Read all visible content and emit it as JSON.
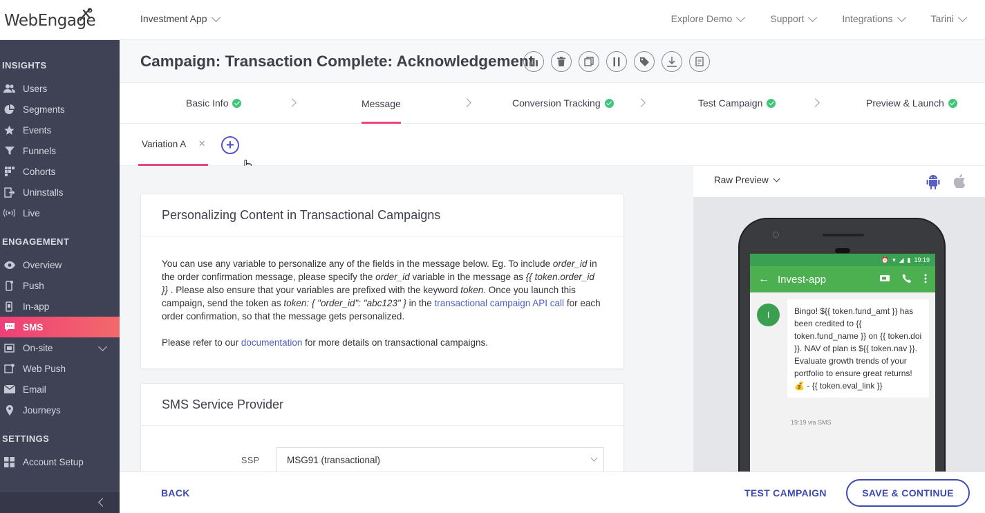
{
  "brand": {
    "logo_text": "WebEngage",
    "accent": "#e8467e",
    "primary": "#3d4bb0",
    "sidebar_bg": "#3f4255"
  },
  "topbar": {
    "app_name": "Investment App",
    "menu": [
      "Explore Demo",
      "Support",
      "Integrations",
      "Tarini"
    ]
  },
  "sidebar": {
    "sections": [
      {
        "title": "INSIGHTS",
        "items": [
          {
            "label": "Users",
            "icon": "users-icon"
          },
          {
            "label": "Segments",
            "icon": "pie-icon"
          },
          {
            "label": "Events",
            "icon": "star-icon"
          },
          {
            "label": "Funnels",
            "icon": "funnel-icon"
          },
          {
            "label": "Cohorts",
            "icon": "grid-icon"
          },
          {
            "label": "Uninstalls",
            "icon": "uninstall-icon"
          },
          {
            "label": "Live",
            "icon": "broadcast-icon"
          }
        ]
      },
      {
        "title": "ENGAGEMENT",
        "items": [
          {
            "label": "Overview",
            "icon": "eye-icon"
          },
          {
            "label": "Push",
            "icon": "mobile-icon"
          },
          {
            "label": "In-app",
            "icon": "mobile-icon"
          },
          {
            "label": "SMS",
            "icon": "sms-icon"
          },
          {
            "label": "On-site",
            "icon": "window-icon"
          },
          {
            "label": "Web Push",
            "icon": "webpush-icon"
          },
          {
            "label": "Email",
            "icon": "mail-icon"
          },
          {
            "label": "Journeys",
            "icon": "journey-icon"
          }
        ]
      },
      {
        "title": "SETTINGS",
        "items": [
          {
            "label": "Account Setup",
            "icon": "grid-icon"
          }
        ]
      }
    ]
  },
  "campaign": {
    "title": "Campaign: Transaction Complete: Acknowledgement",
    "actions": [
      "stats-icon",
      "delete-icon",
      "copy-icon",
      "pause-icon",
      "tag-icon",
      "download-icon",
      "report-icon"
    ]
  },
  "steps": [
    {
      "label": "Basic Info",
      "done": true
    },
    {
      "label": "Message",
      "done": false,
      "active": true
    },
    {
      "label": "Conversion Tracking",
      "done": true
    },
    {
      "label": "Test Campaign",
      "done": true
    },
    {
      "label": "Preview & Launch",
      "done": true
    }
  ],
  "variation": {
    "tab_label": "Variation A",
    "close": "×",
    "add": "+"
  },
  "personalize_card": {
    "title": "Personalizing Content in Transactional Campaigns",
    "p1_a": "You can use any variable to personalize any of the fields in the message below. Eg. To include ",
    "p1_order_id": "order_id",
    "p1_b": " in the order confirmation message, please specify the ",
    "p1_order_id2": "order_id",
    "p1_c": " variable in the message as ",
    "p1_token": "{{ token.order_id }}",
    "p1_d": " . Please also ensure that your variables are prefixed with the keyword ",
    "p1_keyword": "token",
    "p1_e": ". Once you launch this campaign, send the token as ",
    "p1_token_json": "token: { \"order_id\": \"abc123\" }",
    "p1_f": " in the ",
    "p1_link": "transactional campaign API call",
    "p1_g": " for each order confirmation, so that the message gets personalized.",
    "p2_a": "Please refer to our ",
    "p2_link": "documentation",
    "p2_b": " for more details on transactional campaigns."
  },
  "ssp_card": {
    "title": "SMS Service Provider",
    "ssp_label": "SSP",
    "ssp_value": "MSG91 (transactional)"
  },
  "preview": {
    "mode": "Raw Preview",
    "os": [
      "android-icon",
      "apple-icon"
    ],
    "status_time": "19:19",
    "app_title": "Invest-app",
    "avatar_letter": "I",
    "message": "Bingo! ${{ token.fund_amt }} has been credited to {{ token.fund_name }} on {{ token.doi }}. NAV of plan is ${{ token.nav }}. Evaluate growth trends of your portfolio to ensure great returns! 💰 - {{ token.eval_link }}",
    "timestamp": "19:19 via SMS"
  },
  "footer": {
    "back": "BACK",
    "test": "TEST CAMPAIGN",
    "save": "SAVE & CONTINUE"
  }
}
